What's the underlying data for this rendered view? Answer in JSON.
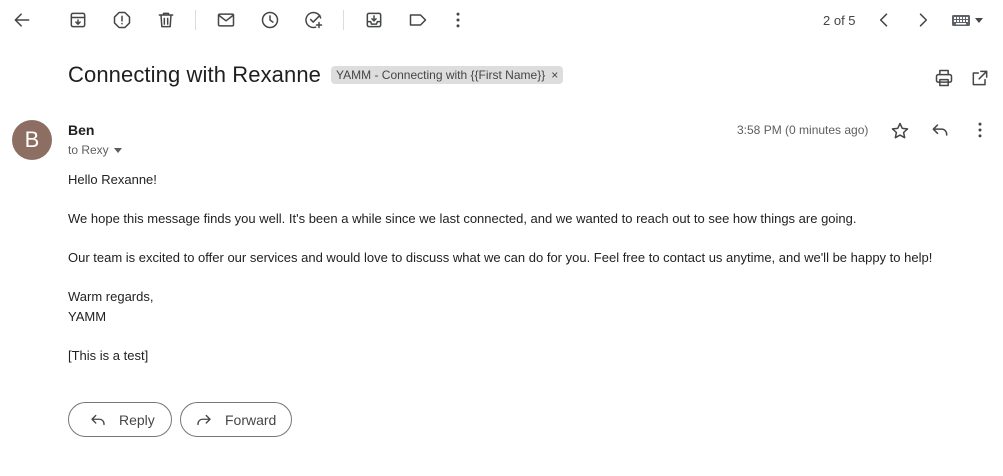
{
  "toolbar": {
    "icons": [
      "back-arrow-icon",
      "archive-icon",
      "report-spam-icon",
      "delete-icon",
      "mark-unread-icon",
      "snooze-icon",
      "add-task-icon",
      "move-to-icon",
      "label-icon",
      "more-vert-icon"
    ],
    "pager_text": "2 of 5",
    "input_tools_icon": "keyboard-icon"
  },
  "message": {
    "subject": "Connecting with Rexanne",
    "label_chip": "YAMM - Connecting with {{First Name}}",
    "label_remove": "×",
    "avatar_letter": "B",
    "avatar_color": "#8d6e63",
    "sender_name": "Ben",
    "to_line": "to Rexy",
    "timestamp": "3:58 PM (0 minutes ago)",
    "body": {
      "greeting": "Hello Rexanne!",
      "para1": "We hope this message finds you well. It's been a while since we last connected, and we wanted to reach out to see how things are going.",
      "para2": "Our team is excited to offer our services and would love to discuss what we can do for you. Feel free to contact us anytime, and we'll be happy to help!",
      "signoff": "Warm regards,",
      "signature": "YAMM",
      "note": "[This is a test]"
    }
  },
  "actions": {
    "reply_label": "Reply",
    "forward_label": "Forward"
  }
}
